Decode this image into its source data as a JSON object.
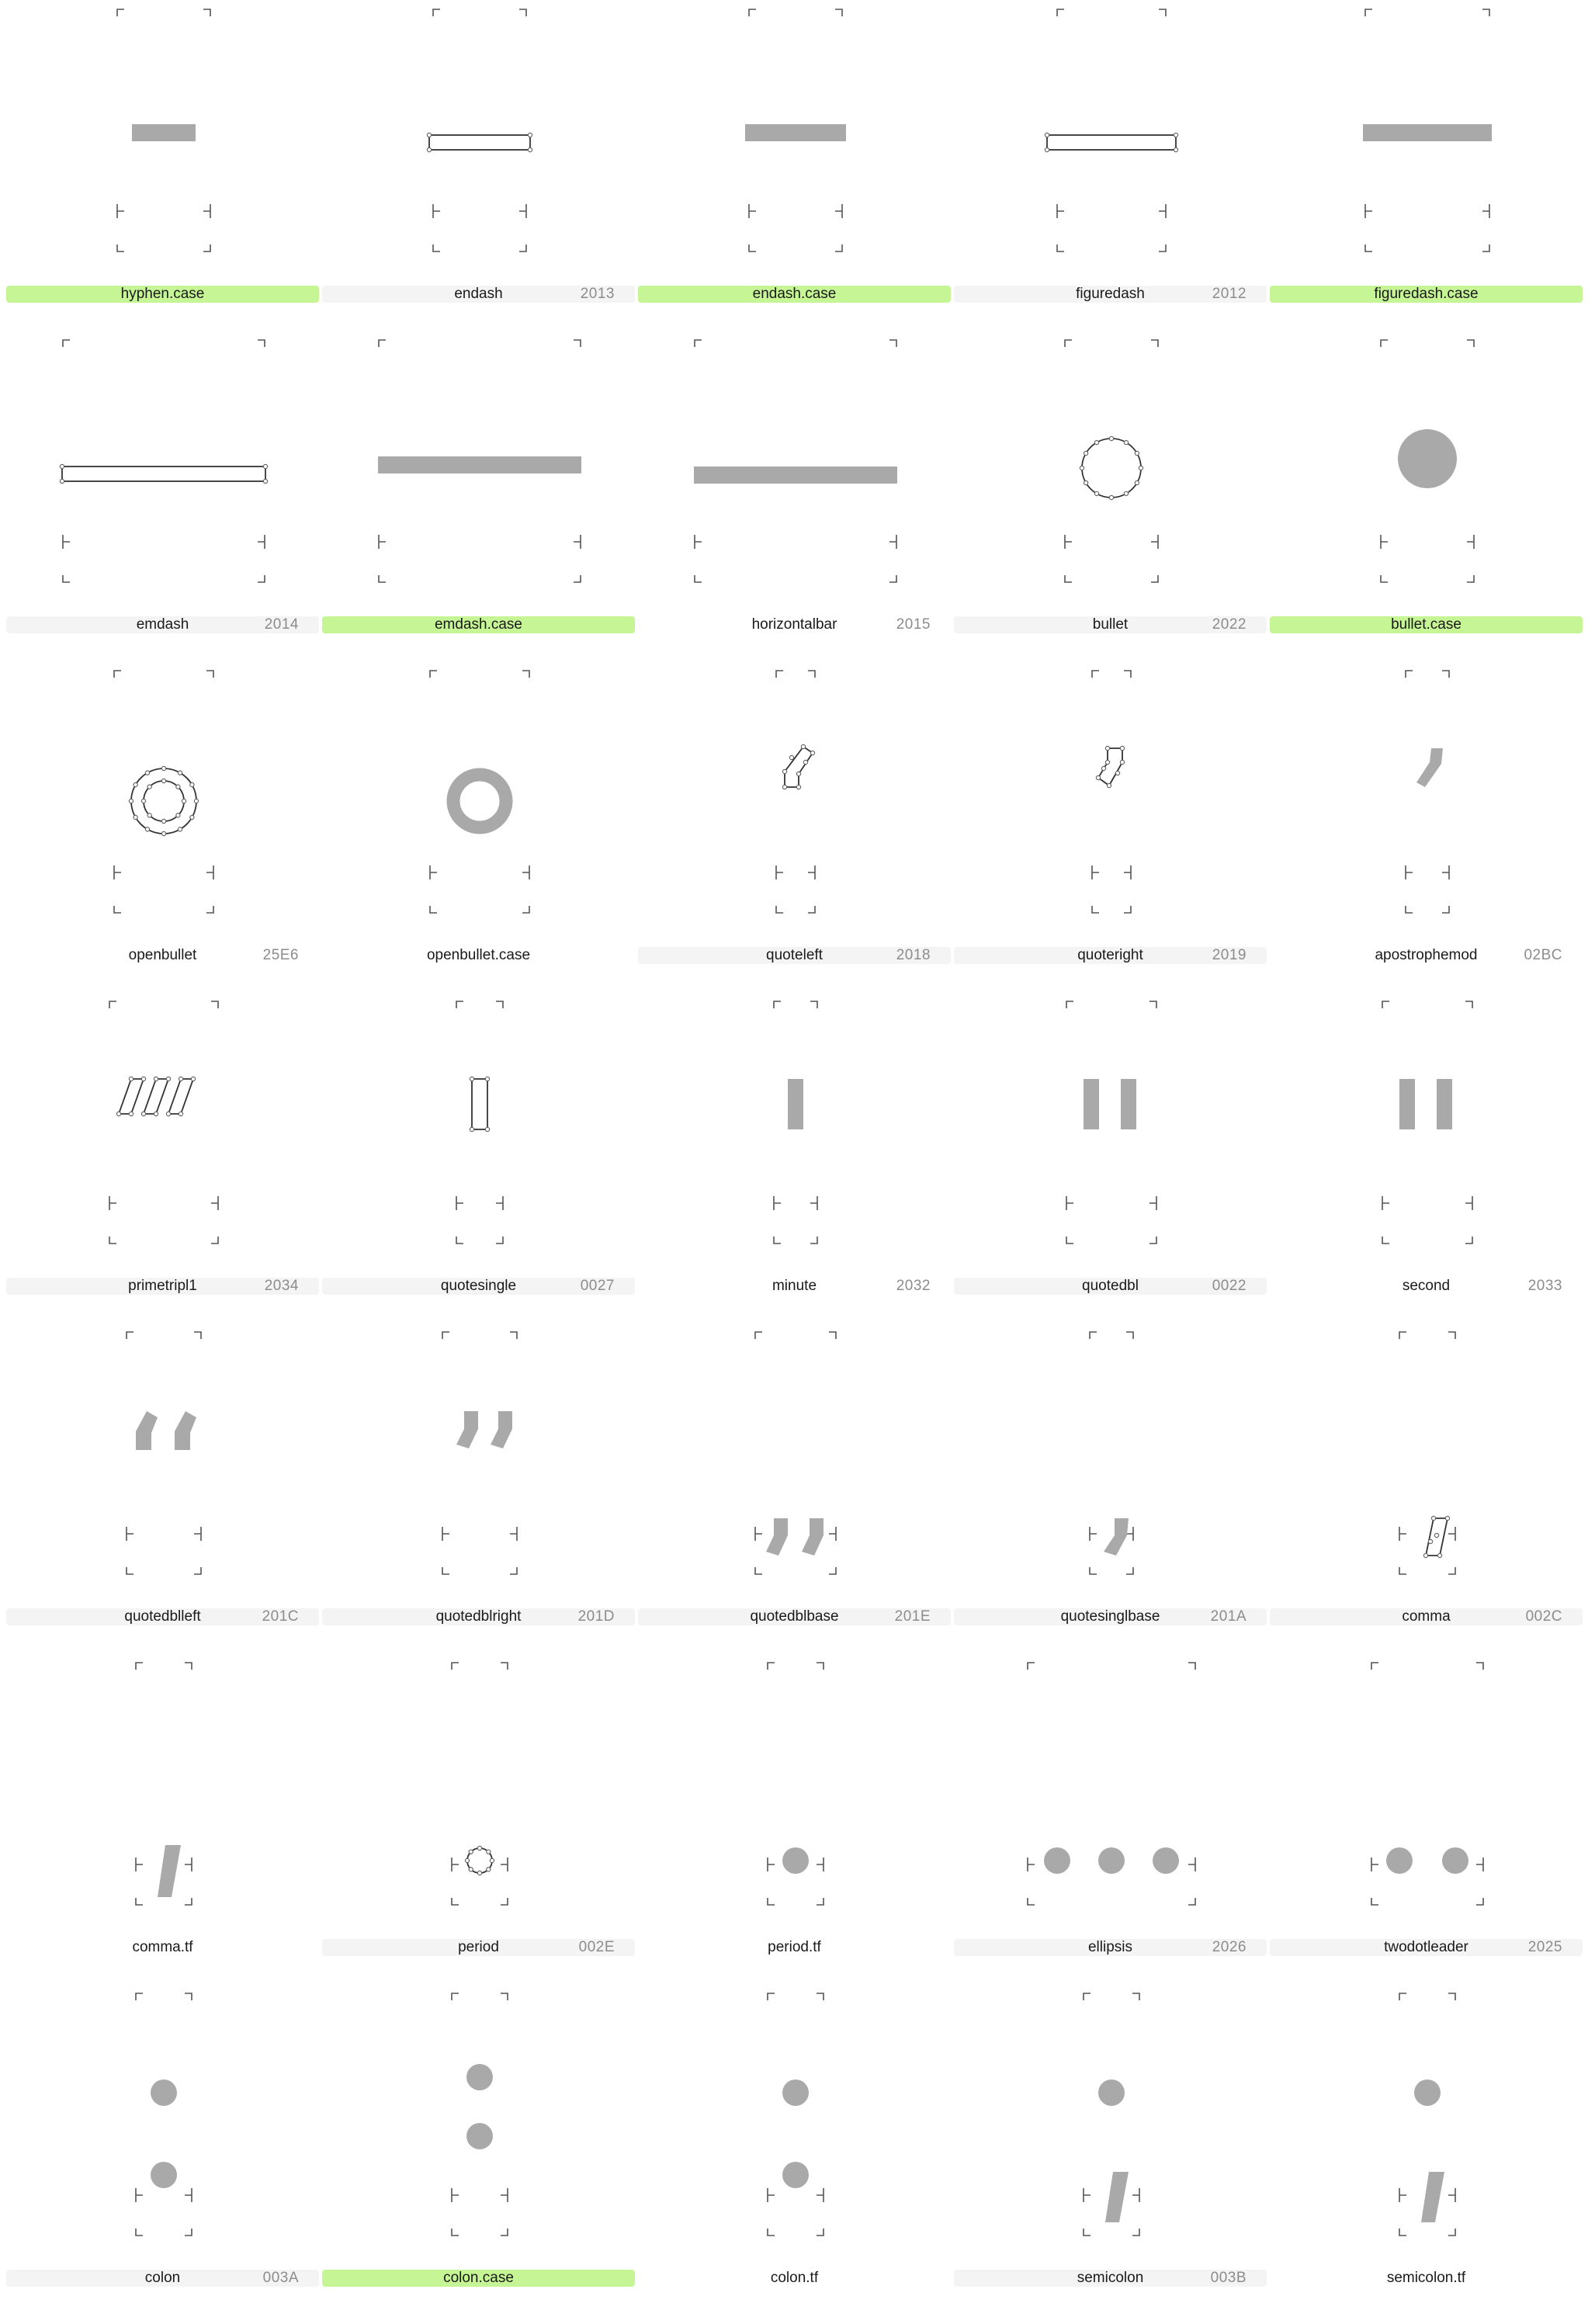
{
  "glyphs": [
    {
      "name": "hyphen.case",
      "code": "",
      "highlight": "green"
    },
    {
      "name": "endash",
      "code": "2013",
      "highlight": "gray"
    },
    {
      "name": "endash.case",
      "code": "",
      "highlight": "green"
    },
    {
      "name": "figuredash",
      "code": "2012",
      "highlight": "gray"
    },
    {
      "name": "figuredash.case",
      "code": "",
      "highlight": "green"
    },
    {
      "name": "emdash",
      "code": "2014",
      "highlight": "gray"
    },
    {
      "name": "emdash.case",
      "code": "",
      "highlight": "green"
    },
    {
      "name": "horizontalbar",
      "code": "2015",
      "highlight": "none"
    },
    {
      "name": "bullet",
      "code": "2022",
      "highlight": "gray"
    },
    {
      "name": "bullet.case",
      "code": "",
      "highlight": "green"
    },
    {
      "name": "openbullet",
      "code": "25E6",
      "highlight": "none"
    },
    {
      "name": "openbullet.case",
      "code": "",
      "highlight": "none"
    },
    {
      "name": "quoteleft",
      "code": "2018",
      "highlight": "gray"
    },
    {
      "name": "quoteright",
      "code": "2019",
      "highlight": "gray"
    },
    {
      "name": "apostrophemod",
      "code": "02BC",
      "highlight": "none"
    },
    {
      "name": "primetripl1",
      "code": "2034",
      "highlight": "gray"
    },
    {
      "name": "quotesingle",
      "code": "0027",
      "highlight": "gray"
    },
    {
      "name": "minute",
      "code": "2032",
      "highlight": "none"
    },
    {
      "name": "quotedbl",
      "code": "0022",
      "highlight": "gray"
    },
    {
      "name": "second",
      "code": "2033",
      "highlight": "none"
    },
    {
      "name": "quotedblleft",
      "code": "201C",
      "highlight": "gray"
    },
    {
      "name": "quotedblright",
      "code": "201D",
      "highlight": "gray"
    },
    {
      "name": "quotedblbase",
      "code": "201E",
      "highlight": "gray"
    },
    {
      "name": "quotesinglbase",
      "code": "201A",
      "highlight": "gray"
    },
    {
      "name": "comma",
      "code": "002C",
      "highlight": "gray"
    },
    {
      "name": "comma.tf",
      "code": "",
      "highlight": "none"
    },
    {
      "name": "period",
      "code": "002E",
      "highlight": "gray"
    },
    {
      "name": "period.tf",
      "code": "",
      "highlight": "none"
    },
    {
      "name": "ellipsis",
      "code": "2026",
      "highlight": "gray"
    },
    {
      "name": "twodotleader",
      "code": "2025",
      "highlight": "gray"
    },
    {
      "name": "colon",
      "code": "003A",
      "highlight": "gray"
    },
    {
      "name": "colon.case",
      "code": "",
      "highlight": "green"
    },
    {
      "name": "colon.tf",
      "code": "",
      "highlight": "none"
    },
    {
      "name": "semicolon",
      "code": "003B",
      "highlight": "gray"
    },
    {
      "name": "semicolon.tf",
      "code": "",
      "highlight": "none"
    }
  ],
  "colors": {
    "highlight_green": "#c6f596",
    "label_gray": "#f4f4f4",
    "glyph_fill": "#a9a9a9",
    "outline_stroke": "#333333"
  }
}
